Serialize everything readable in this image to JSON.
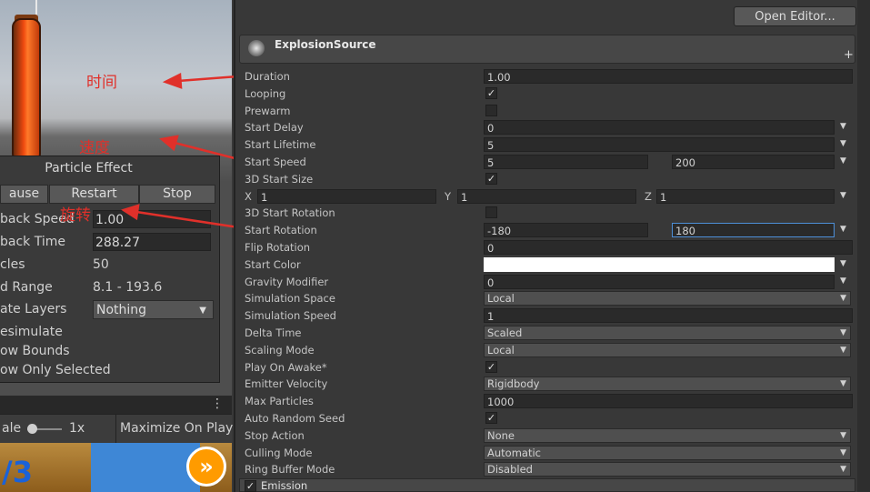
{
  "particle_effect": {
    "title": "Particle Effect",
    "buttons": [
      "ause",
      "Restart",
      "Stop"
    ],
    "rows": [
      {
        "label": "back Speed",
        "value": "1.00",
        "kind": "field"
      },
      {
        "label": "back Time",
        "value": "288.27",
        "kind": "field"
      },
      {
        "label": "cles",
        "value": "50",
        "kind": "text"
      },
      {
        "label": "d Range",
        "value": "8.1 - 193.6",
        "kind": "text"
      }
    ],
    "layers_label": "ate Layers",
    "layers_value": "Nothing",
    "options": [
      "esimulate",
      "ow Bounds",
      "ow Only Selected"
    ]
  },
  "game_bar": {
    "menu": "⋮",
    "scale_label": "ale",
    "scale_value": "1x",
    "maximize": "Maximize On Play"
  },
  "game_view": {
    "counter": "/3",
    "ff": "»"
  },
  "annotations": {
    "time": "时间",
    "speed": "速度",
    "rotation": "旋转"
  },
  "inspector": {
    "open_editor": "Open Editor...",
    "module_title": "ExplosionSource",
    "module_plus": "+",
    "props": [
      {
        "label": "Duration",
        "kind": "field",
        "value": "1.00"
      },
      {
        "label": "Looping",
        "kind": "check",
        "checked": true
      },
      {
        "label": "Prewarm",
        "kind": "check",
        "checked": false
      },
      {
        "label": "Start Delay",
        "kind": "field-arrow",
        "value": "0"
      },
      {
        "label": "Start Lifetime",
        "kind": "field-arrow",
        "value": "5"
      },
      {
        "label": "Start Speed",
        "kind": "range",
        "min": "5",
        "max": "200"
      },
      {
        "label": "3D Start Size",
        "kind": "check",
        "checked": true
      },
      {
        "label": "",
        "kind": "xyz",
        "x": "1",
        "y": "1",
        "z": "1"
      },
      {
        "label": "3D Start Rotation",
        "kind": "check",
        "checked": false
      },
      {
        "label": "Start Rotation",
        "kind": "range",
        "min": "-180",
        "max": "180",
        "selected": true
      },
      {
        "label": "Flip Rotation",
        "kind": "field",
        "value": "0"
      },
      {
        "label": "Start Color",
        "kind": "color",
        "value": "#ffffff"
      },
      {
        "label": "Gravity Modifier",
        "kind": "field-arrow",
        "value": "0"
      },
      {
        "label": "Simulation Space",
        "kind": "drop",
        "value": "Local"
      },
      {
        "label": "Simulation Speed",
        "kind": "field",
        "value": "1"
      },
      {
        "label": "Delta Time",
        "kind": "drop",
        "value": "Scaled"
      },
      {
        "label": "Scaling Mode",
        "kind": "drop",
        "value": "Local"
      },
      {
        "label": "Play On Awake*",
        "kind": "check",
        "checked": true
      },
      {
        "label": "Emitter Velocity",
        "kind": "drop",
        "value": "Rigidbody"
      },
      {
        "label": "Max Particles",
        "kind": "field",
        "value": "1000"
      },
      {
        "label": "Auto Random Seed",
        "kind": "check",
        "checked": true
      },
      {
        "label": "Stop Action",
        "kind": "drop",
        "value": "None"
      },
      {
        "label": "Culling Mode",
        "kind": "drop",
        "value": "Automatic"
      },
      {
        "label": "Ring Buffer Mode",
        "kind": "drop",
        "value": "Disabled"
      }
    ],
    "emission": "Emission"
  }
}
